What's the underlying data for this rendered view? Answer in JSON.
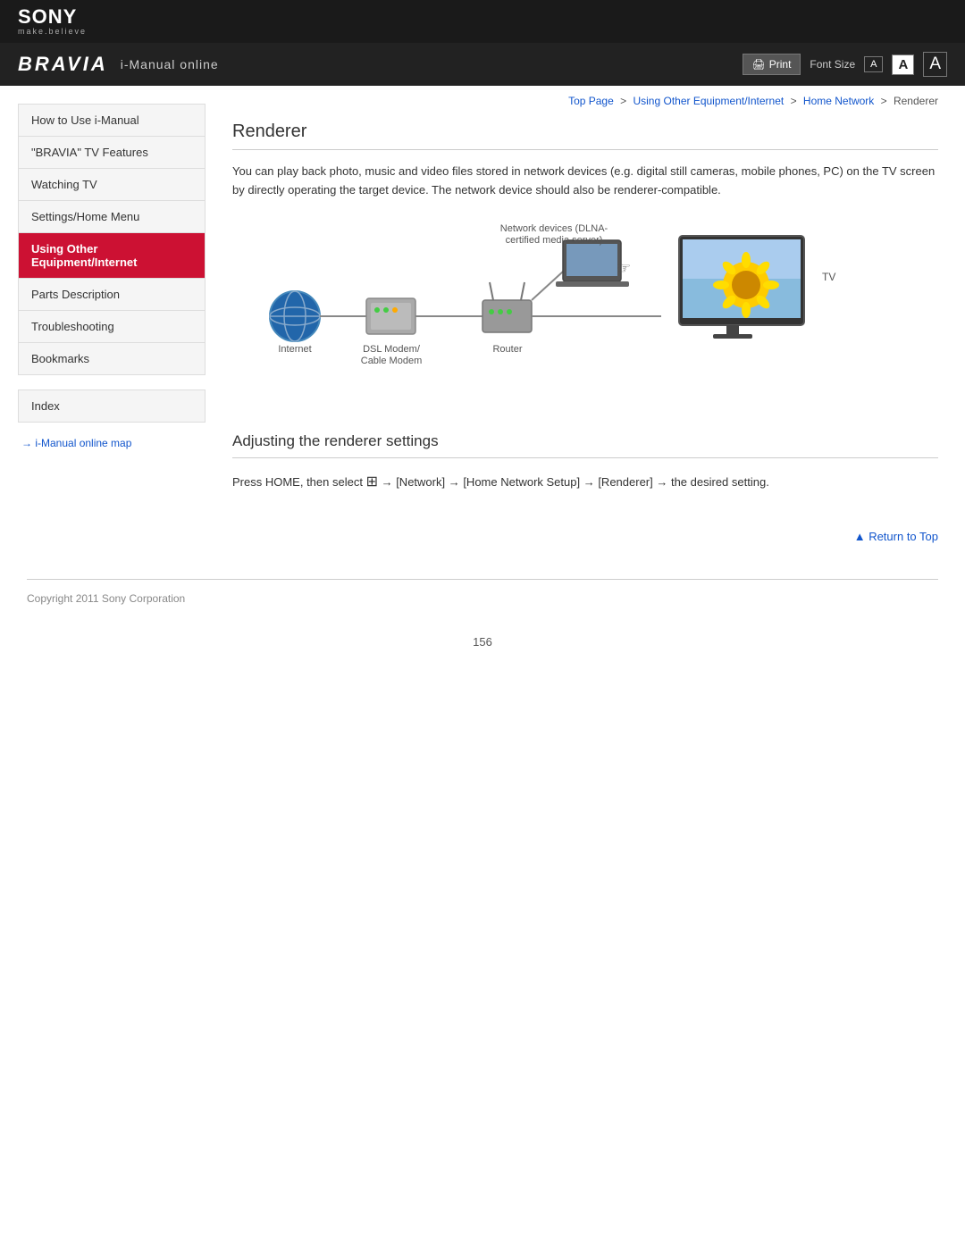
{
  "header": {
    "sony_logo": "SONY",
    "sony_tagline": "make.believe",
    "bravia_text": "BRAVIA",
    "subtitle": "i-Manual online",
    "print_label": "Print",
    "font_size_label": "Font Size",
    "font_size_options": [
      "A",
      "A",
      "A"
    ]
  },
  "breadcrumb": {
    "top_page": "Top Page",
    "link2": "Using Other Equipment/Internet",
    "link3": "Home Network",
    "current": "Renderer"
  },
  "sidebar": {
    "nav_items": [
      {
        "id": "how-to-use",
        "label": "How to Use i-Manual",
        "active": false
      },
      {
        "id": "bravia-tv-features",
        "label": "\"BRAVIA\" TV Features",
        "active": false
      },
      {
        "id": "watching-tv",
        "label": "Watching TV",
        "active": false
      },
      {
        "id": "settings-home-menu",
        "label": "Settings/Home Menu",
        "active": false
      },
      {
        "id": "using-other-equipment",
        "label": "Using Other Equipment/Internet",
        "active": true
      },
      {
        "id": "parts-description",
        "label": "Parts Description",
        "active": false
      },
      {
        "id": "troubleshooting",
        "label": "Troubleshooting",
        "active": false
      },
      {
        "id": "bookmarks",
        "label": "Bookmarks",
        "active": false
      }
    ],
    "index_label": "Index",
    "manual_map_link": "i-Manual online map",
    "arrow": "→"
  },
  "content": {
    "page_title": "Renderer",
    "intro_text": "You can play back photo, music and video files stored in network devices (e.g. digital still cameras, mobile phones, PC) on the TV screen by directly operating the target device. The network device should also be renderer-compatible.",
    "diagram": {
      "network_devices_label": "Network devices (DLNA-\ncertified media server)",
      "dsl_modem_label": "DSL Modem/\nCable Modem",
      "internet_label": "Internet",
      "router_label": "Router",
      "tv_label": "TV"
    },
    "section_title": "Adjusting the renderer settings",
    "settings_text": "Press HOME, then select  → [Network] → [Home Network Setup] → [Renderer] → the desired setting.",
    "return_top": "Return to Top"
  },
  "footer": {
    "copyright": "Copyright 2011 Sony Corporation",
    "page_number": "156"
  }
}
